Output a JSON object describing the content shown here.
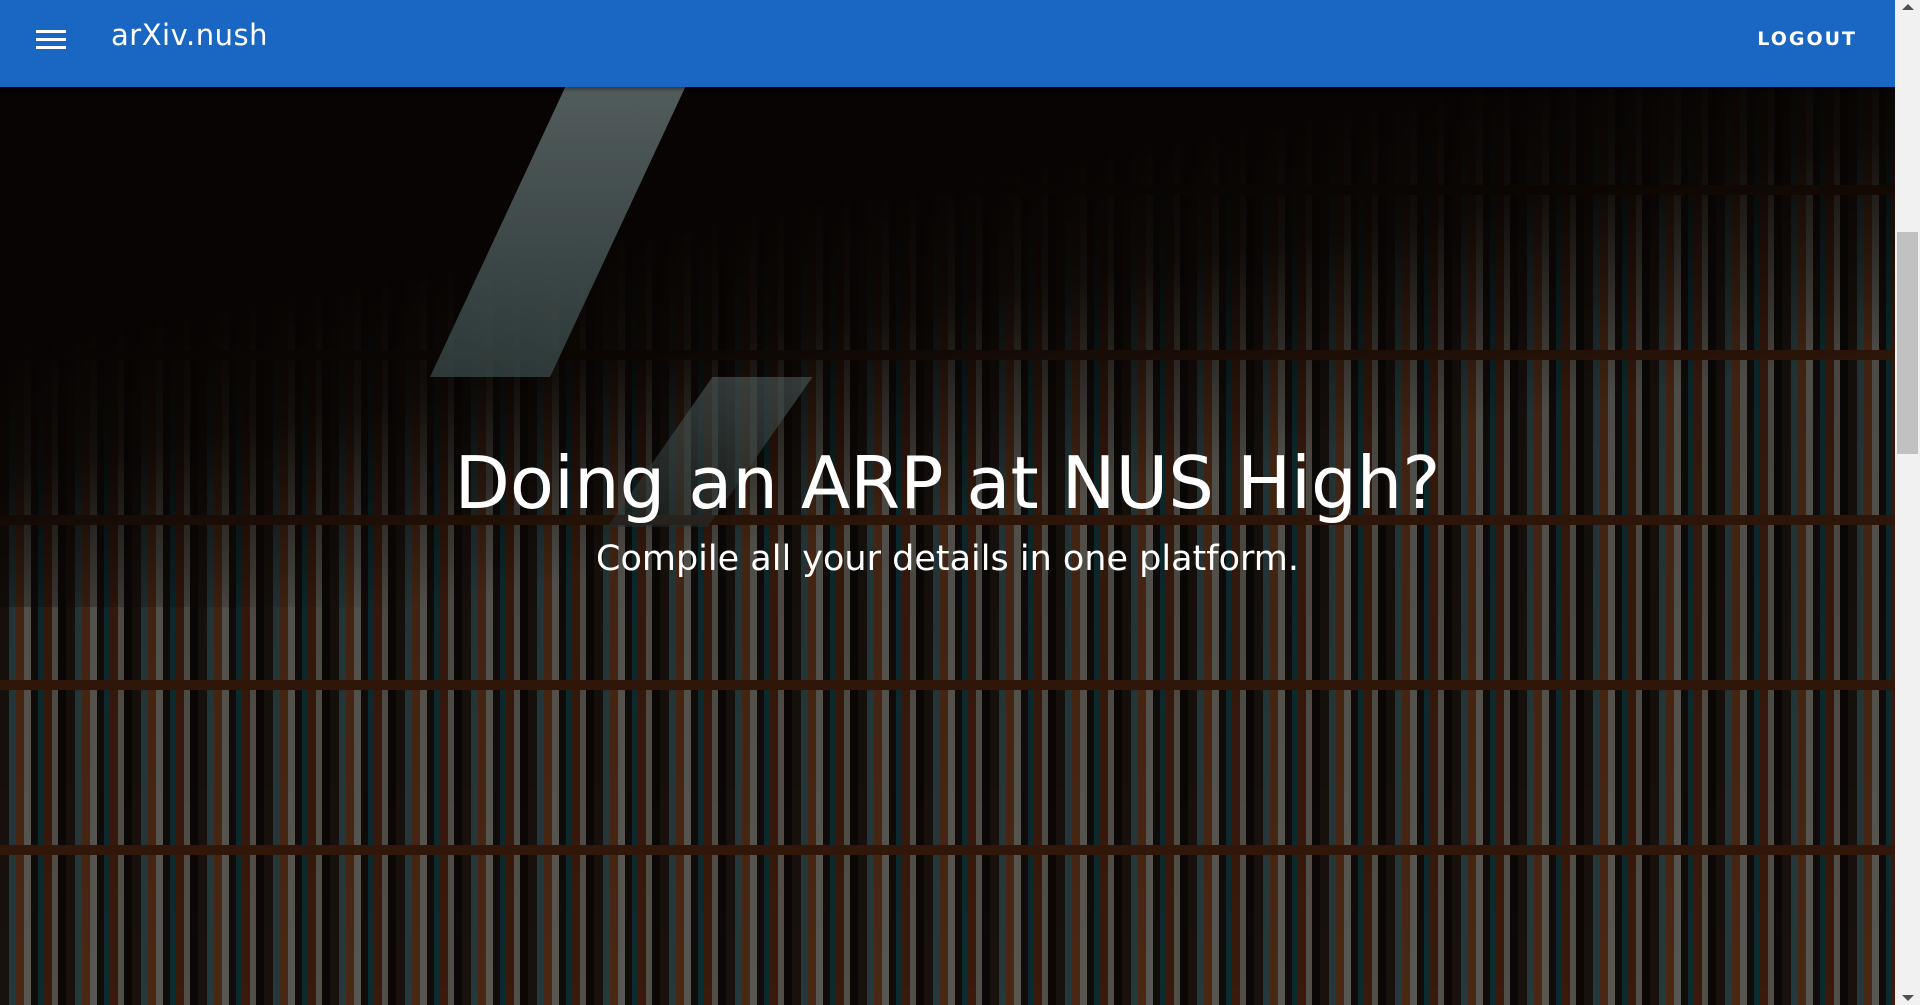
{
  "appbar": {
    "title": "arXiv.nush",
    "logout_label": "LOGOUT",
    "menu_icon": "hamburger-menu-icon"
  },
  "hero": {
    "headline": "Doing an ARP at NUS High?",
    "subtitle": "Compile all your details in one platform."
  },
  "colors": {
    "appbar": "#1a67c3"
  }
}
